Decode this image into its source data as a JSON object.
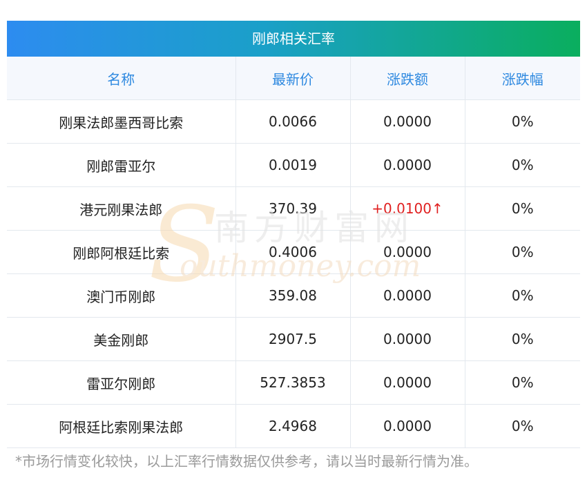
{
  "title": "刚郎相关汇率",
  "headers": [
    "名称",
    "最新价",
    "涨跌额",
    "涨跌幅"
  ],
  "rows": [
    {
      "name": "刚果法郎墨西哥比索",
      "price": "0.0066",
      "change": "0.0000",
      "pct": "0%"
    },
    {
      "name": "刚郎雷亚尔",
      "price": "0.0019",
      "change": "0.0000",
      "pct": "0%"
    },
    {
      "name": "港元刚果法郎",
      "price": "370.39",
      "change": "+0.0100↑",
      "pct": "0%",
      "up": true
    },
    {
      "name": "刚郎阿根廷比索",
      "price": "0.4006",
      "change": "0.0000",
      "pct": "0%"
    },
    {
      "name": "澳门币刚郎",
      "price": "359.08",
      "change": "0.0000",
      "pct": "0%"
    },
    {
      "name": "美金刚郎",
      "price": "2907.5",
      "change": "0.0000",
      "pct": "0%"
    },
    {
      "name": "雷亚尔刚郎",
      "price": "527.3853",
      "change": "0.0000",
      "pct": "0%"
    },
    {
      "name": "阿根廷比索刚果法郎",
      "price": "2.4968",
      "change": "0.0000",
      "pct": "0%"
    }
  ],
  "note": "*市场行情变化较快，以上汇率行情数据仅供参考，请以当时最新行情为准。",
  "watermark": {
    "cn": "南方财富网",
    "en": "outhmoney.com",
    "s": "S"
  },
  "colors": {
    "header_text": "#2e89e0",
    "up": "#e02020",
    "title_gradient_start": "#2d8cf0",
    "title_gradient_end": "#0aae5e"
  }
}
